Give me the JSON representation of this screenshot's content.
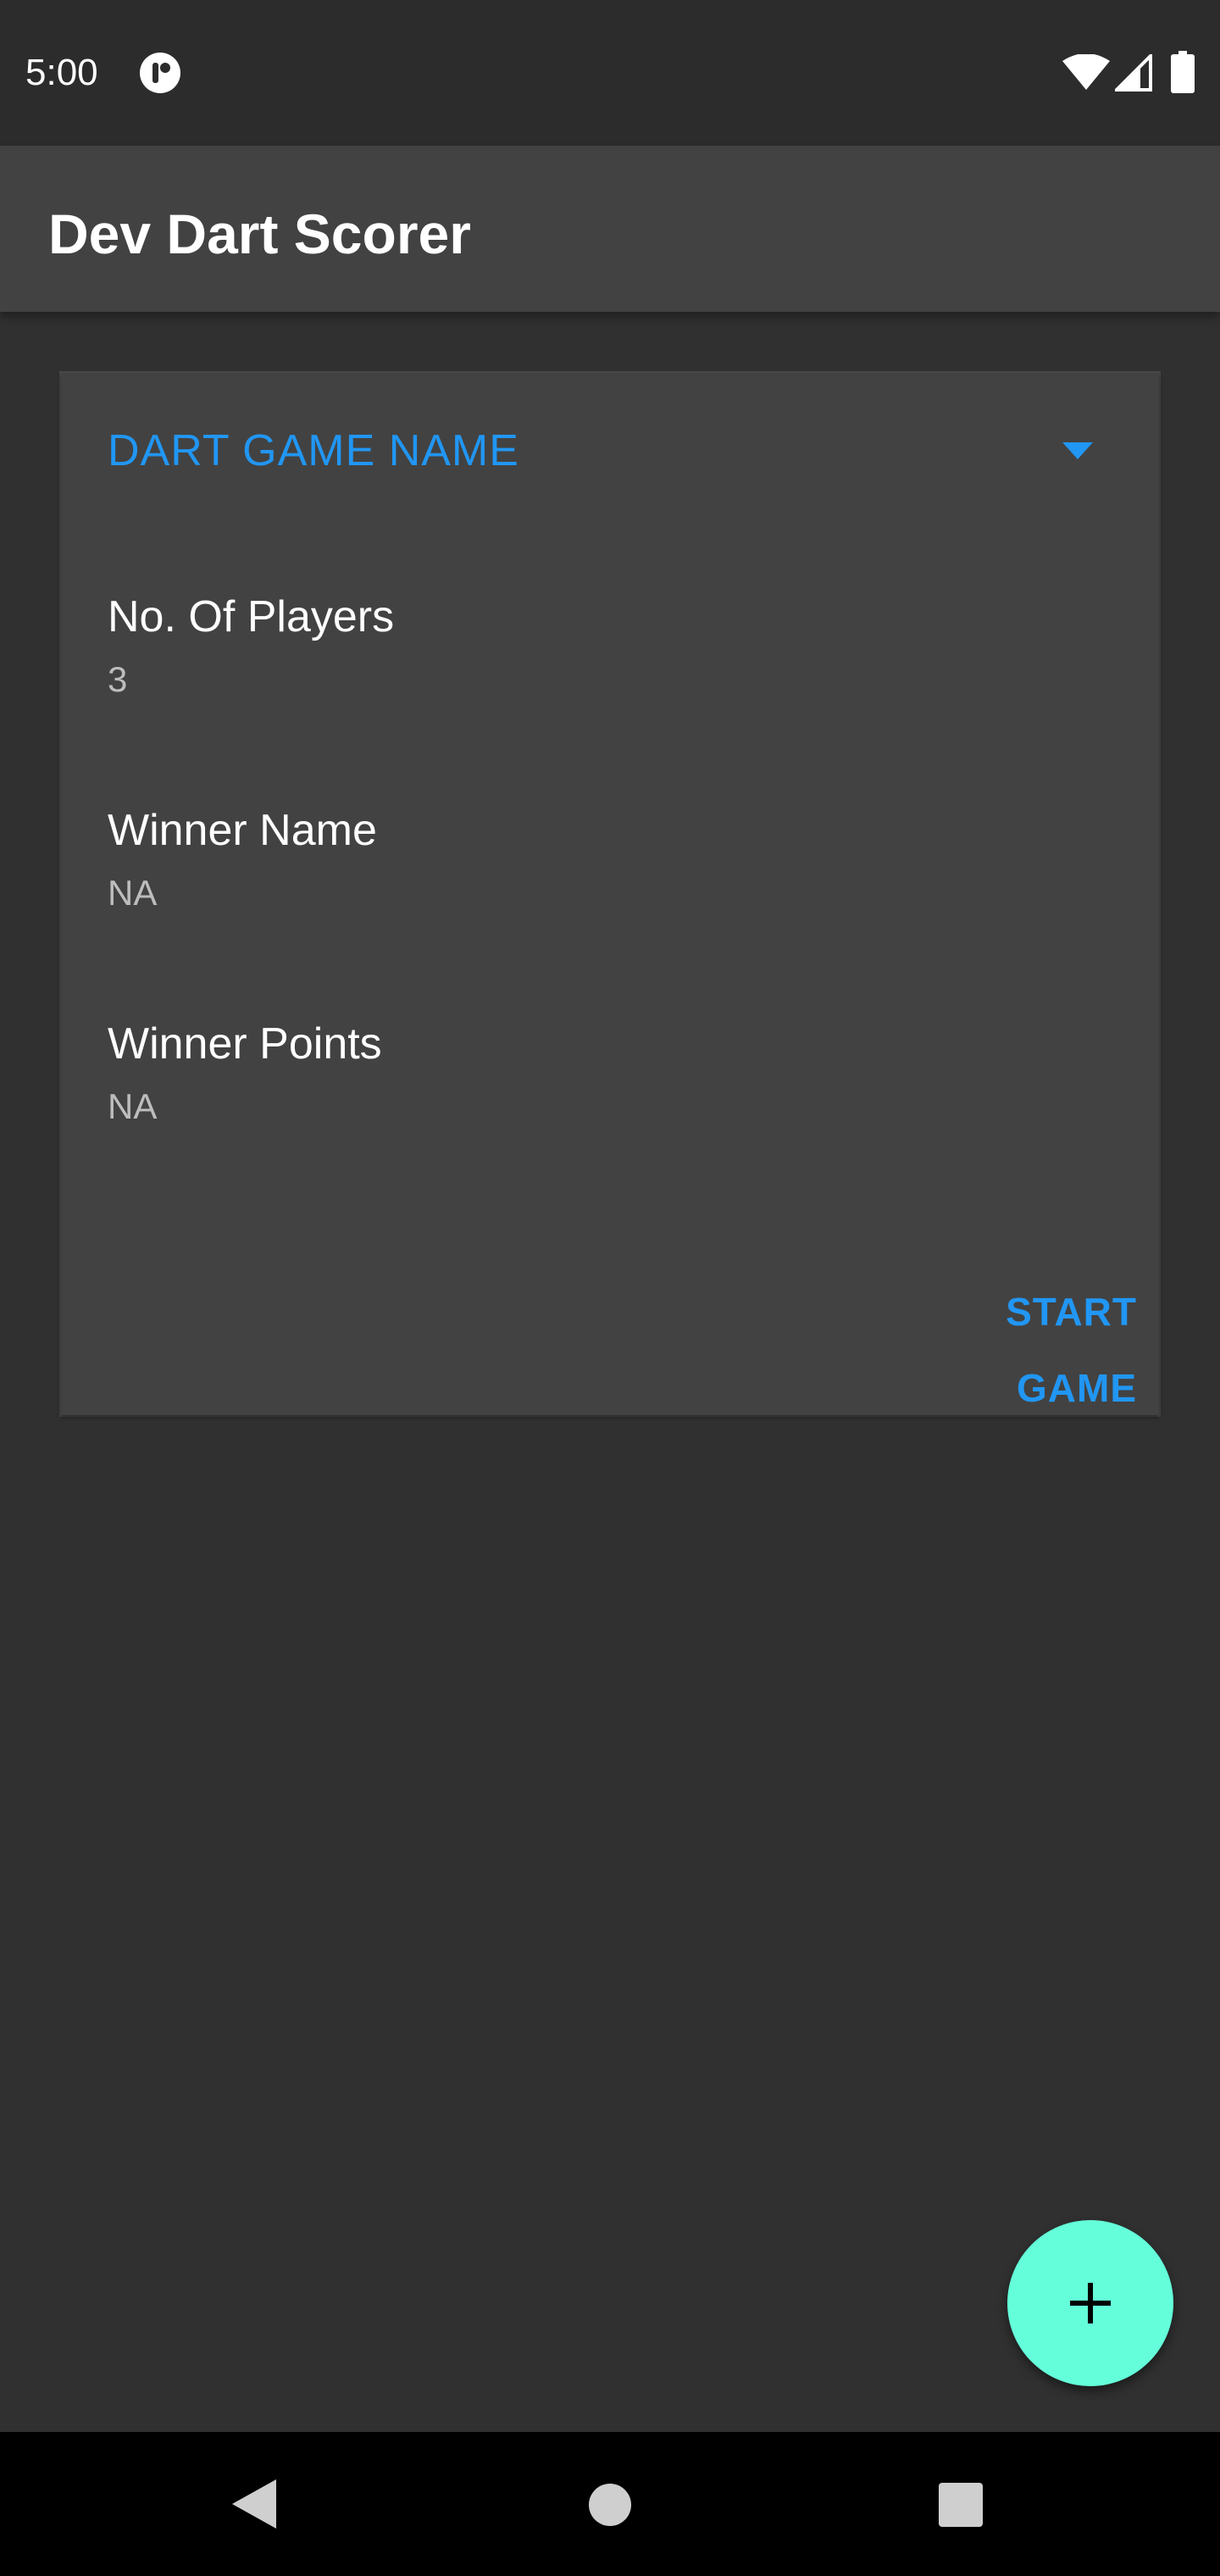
{
  "status_bar": {
    "time": "5:00",
    "app_icon": "notification-app-icon",
    "wifi_icon": "wifi-icon",
    "signal_icon": "cell-signal-icon",
    "battery_icon": "battery-icon"
  },
  "app_bar": {
    "title": "Dev Dart Scorer"
  },
  "game_card": {
    "game_name": "DART GAME NAME",
    "dropdown_icon": "arrow-drop-down-icon",
    "fields": [
      {
        "label": "No. Of Players",
        "value": "3"
      },
      {
        "label": "Winner Name",
        "value": "NA"
      },
      {
        "label": "Winner Points",
        "value": "NA"
      }
    ],
    "start_button_label": "START GAME"
  },
  "fab": {
    "icon": "plus-icon"
  },
  "nav_bar": {
    "back_icon": "back-icon",
    "home_icon": "home-icon",
    "recents_icon": "recents-icon"
  },
  "colors": {
    "background": "#303030",
    "surface": "#424242",
    "accent": "#2196f3",
    "fab": "#64ffda"
  }
}
